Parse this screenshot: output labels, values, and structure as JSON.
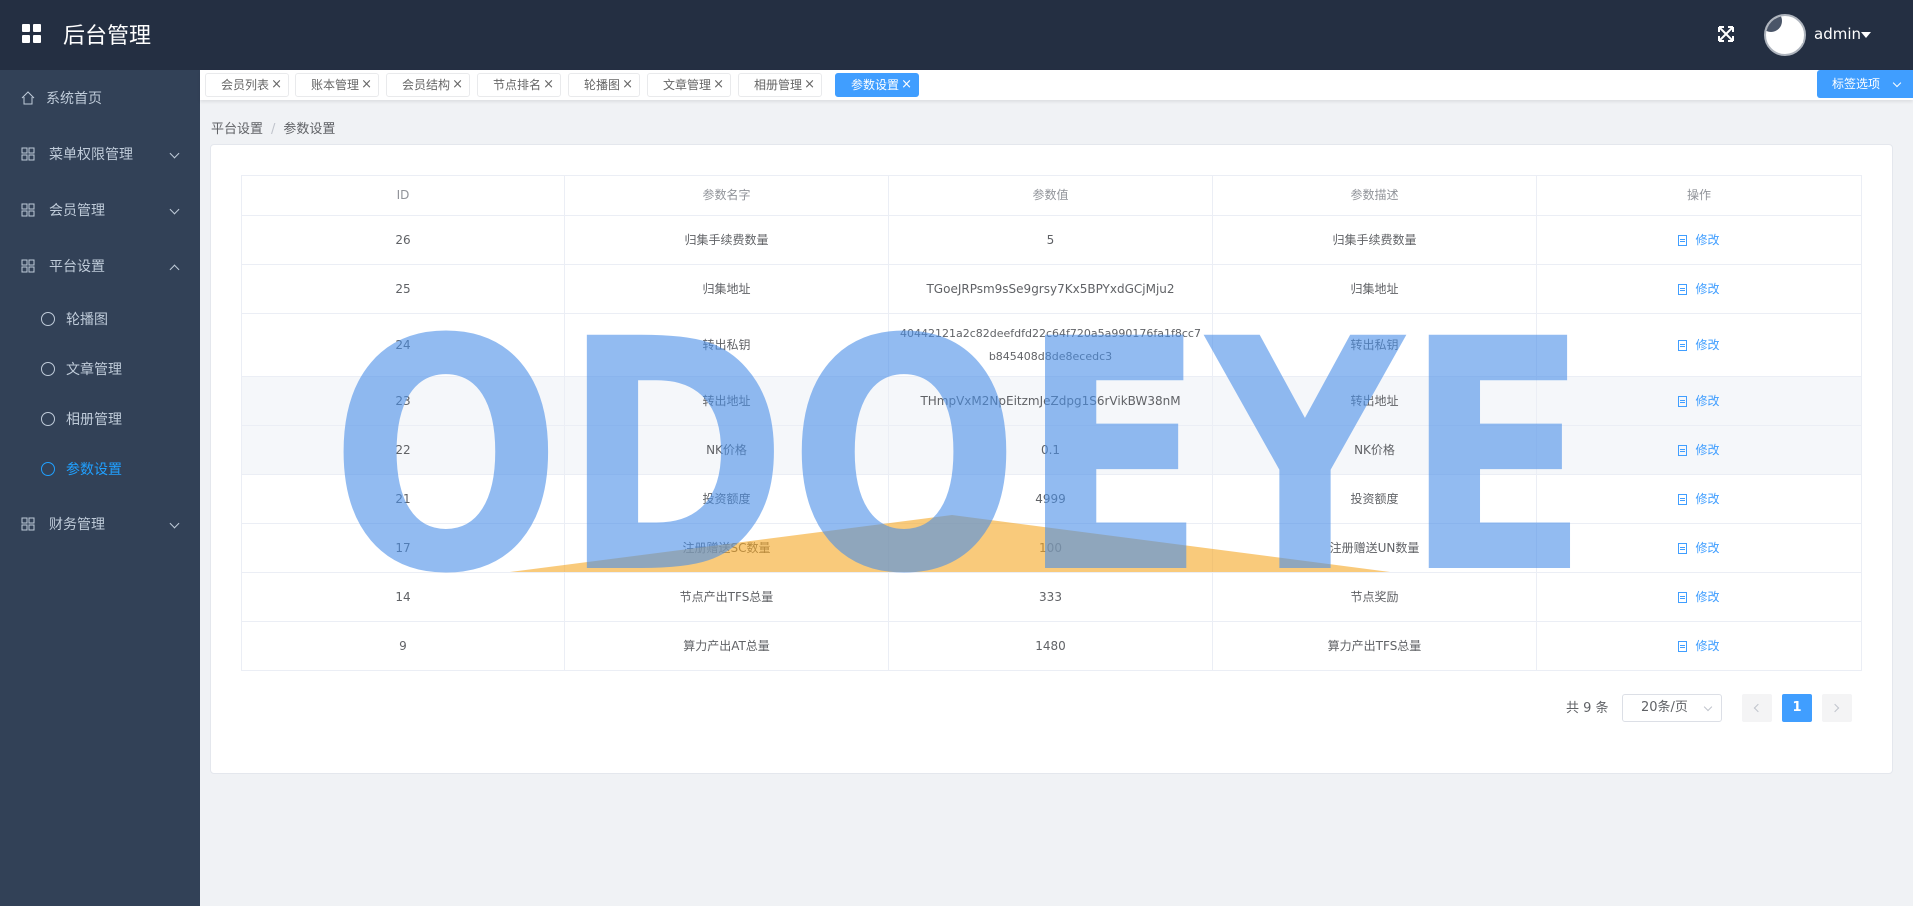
{
  "header": {
    "title": "后台管理",
    "username": "admin"
  },
  "sidebar": {
    "items": [
      {
        "label": "系统首页"
      },
      {
        "label": "菜单权限管理"
      },
      {
        "label": "会员管理"
      },
      {
        "label": "平台设置"
      },
      {
        "label": "财务管理"
      }
    ],
    "subitems": [
      {
        "label": "轮播图"
      },
      {
        "label": "文章管理"
      },
      {
        "label": "相册管理"
      },
      {
        "label": "参数设置"
      }
    ]
  },
  "tabs": [
    {
      "label": "会员列表"
    },
    {
      "label": "账本管理"
    },
    {
      "label": "会员结构"
    },
    {
      "label": "节点排名"
    },
    {
      "label": "轮播图"
    },
    {
      "label": "文章管理"
    },
    {
      "label": "相册管理"
    },
    {
      "label": "参数设置"
    }
  ],
  "tab_options": "标签选项",
  "breadcrumb": [
    "平台设置",
    "参数设置"
  ],
  "table": {
    "headers": [
      "ID",
      "参数名字",
      "参数值",
      "参数描述",
      "操作"
    ],
    "action_label": "修改",
    "rows": [
      {
        "id": "26",
        "name": "归集手续费数量",
        "value": "5",
        "desc": "归集手续费数量"
      },
      {
        "id": "25",
        "name": "归集地址",
        "value": "TGoeJRPsm9sSe9grsy7Kx5BPYxdGCjMju2",
        "desc": "归集地址"
      },
      {
        "id": "24",
        "name": "转出私钥",
        "value": "40442121a2c82deefdfd22c64f720a5a990176fa1f8cc7b845408d8de8ecedc3",
        "desc": "转出私钥"
      },
      {
        "id": "23",
        "name": "转出地址",
        "value": "THmpVxM2NpEitzmJeZdpg1S6rVikBW38nM",
        "desc": "转出地址"
      },
      {
        "id": "22",
        "name": "NK价格",
        "value": "0.1",
        "desc": "NK价格"
      },
      {
        "id": "21",
        "name": "投资额度",
        "value": "4999",
        "desc": "投资额度"
      },
      {
        "id": "17",
        "name": "注册赠送SC数量",
        "value": "100",
        "desc": "注册赠送UN数量"
      },
      {
        "id": "14",
        "name": "节点产出TFS总量",
        "value": "333",
        "desc": "节点奖励"
      },
      {
        "id": "9",
        "name": "算力产出AT总量",
        "value": "1480",
        "desc": "算力产出TFS总量"
      }
    ]
  },
  "pagination": {
    "total": "共 9 条",
    "page_size": "20条/页",
    "current": "1"
  },
  "watermark": {
    "text": "ODOEYE",
    "color": "#4a8fe8",
    "accent": "#f5a623"
  },
  "colors": {
    "header_bg": "#242f42",
    "sidebar_bg": "#324157",
    "accent": "#409eff",
    "active_menu": "#20a0ff"
  }
}
